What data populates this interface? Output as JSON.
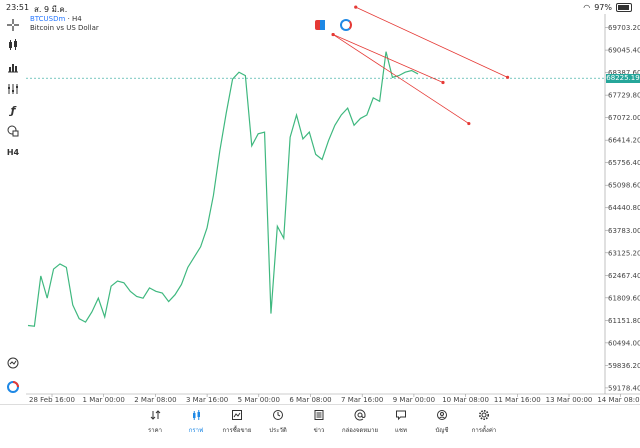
{
  "status": {
    "time": "23:51",
    "date": "ส. 9 มี.ค.",
    "battery": "97%"
  },
  "symbol": {
    "ticker": "BTCUSDm",
    "timeframe": "· H4",
    "description": "Bitcoin vs US Dollar"
  },
  "left_tools": [
    "crosshair-icon",
    "candle-icon",
    "bar-chart-icon",
    "indicators-icon",
    "function-icon",
    "objects-icon",
    "timeframe-label"
  ],
  "timeframe_label": "H4",
  "price_tag": "68225.19",
  "chart_data": {
    "type": "line",
    "x": [
      "28 Feb 16:00",
      "1 Mar 00:00",
      "2 Mar 08:00",
      "3 Mar 16:00",
      "5 Mar 00:00",
      "6 Mar 08:00",
      "7 Mar 16:00",
      "9 Mar 00:00",
      "10 Mar 08:00",
      "11 Mar 16:00",
      "13 Mar 00:00",
      "14 Mar 08:00"
    ],
    "y_ticks": [
      "69703.20",
      "69045.40",
      "68387.60",
      "67729.80",
      "67072.00",
      "66414.20",
      "65756.40",
      "65098.60",
      "64440.80",
      "63783.00",
      "63125.20",
      "62467.40",
      "61809.60",
      "61151.80",
      "60494.00",
      "59836.20",
      "59178.40"
    ],
    "ylim": [
      59000,
      70100
    ],
    "current_price": 68225.19,
    "series": [
      {
        "values": [
          61000,
          60980,
          62450,
          61800,
          62650,
          62800,
          62700,
          61600,
          61200,
          61100,
          61400,
          61800,
          61250,
          62150,
          62300,
          62250,
          62000,
          61850,
          61800,
          62100,
          62000,
          61950,
          61700,
          61900,
          62200,
          62700,
          63000,
          63300,
          63850,
          64800,
          66100,
          67200,
          68200,
          68400,
          68300,
          66250,
          66600,
          66650,
          61350,
          63900,
          63550,
          66500,
          67150,
          66450,
          66650,
          66000,
          65850,
          66400,
          66850,
          67150,
          67350,
          66850,
          67050,
          67150,
          67650,
          67550,
          69000,
          68250,
          68300,
          68400,
          68450,
          68350
        ]
      }
    ],
    "trendlines": [
      {
        "p1": [
          "6 Mar 22:00",
          69500
        ],
        "p2": [
          "9 Mar 18:00",
          68100
        ]
      },
      {
        "p1": [
          "6 Mar 22:00",
          69500
        ],
        "p2": [
          "10 Mar 10:00",
          66900
        ]
      },
      {
        "p1": [
          "7 Mar 12:00",
          70300
        ],
        "p2": [
          "11 Mar 10:00",
          68250
        ]
      }
    ]
  },
  "tabs": [
    {
      "label": "ราคา",
      "icon": "arrows-icon"
    },
    {
      "label": "กราฟ",
      "icon": "candles-icon",
      "active": true
    },
    {
      "label": "การซื้อขาย",
      "icon": "trade-chart-icon"
    },
    {
      "label": "ประวัติ",
      "icon": "clock-icon"
    },
    {
      "label": "ข่าว",
      "icon": "news-icon"
    },
    {
      "label": "กล่องจดหมาย",
      "icon": "at-icon"
    },
    {
      "label": "แชท",
      "icon": "chat-icon"
    },
    {
      "label": "บัญชี",
      "icon": "user-icon"
    },
    {
      "label": "การตั้งค่า",
      "icon": "gear-icon"
    }
  ],
  "colors": {
    "line": "#3fb87f",
    "trend": "#e53935",
    "accent": "#1e88e5",
    "price": "#26a69a"
  }
}
